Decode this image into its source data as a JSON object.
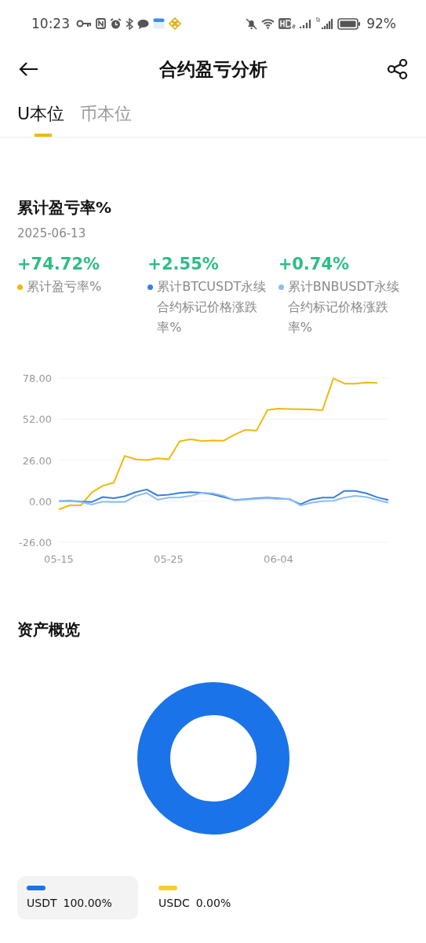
{
  "status_bar": {
    "time": "10:23",
    "battery": "92%"
  },
  "header": {
    "title": "合约盈亏分析"
  },
  "tabs": [
    {
      "label": "U本位",
      "selected": true
    },
    {
      "label": "币本位",
      "selected": false
    }
  ],
  "pnl_section": {
    "title": "累计盈亏率%",
    "date": "2025-06-13",
    "metrics": [
      {
        "value": "+74.72%"
      },
      {
        "value": "+2.55%"
      },
      {
        "value": "+0.74%"
      }
    ],
    "chart_data": {
      "type": "line",
      "categories": [
        "05-15",
        null,
        null,
        null,
        null,
        null,
        null,
        null,
        null,
        null,
        "05-25",
        null,
        null,
        null,
        null,
        null,
        null,
        null,
        null,
        null,
        "06-04",
        null,
        null,
        null,
        null,
        null,
        null,
        null,
        null,
        null,
        null
      ],
      "yticks": [
        {
          "value": 78,
          "label": "78.00"
        },
        {
          "value": 52,
          "label": "52.00"
        },
        {
          "value": 26,
          "label": "26.00"
        },
        {
          "value": 0,
          "label": "0.00"
        },
        {
          "value": -26,
          "label": "-26.00"
        }
      ],
      "ylim": [
        -26,
        78
      ],
      "grid": true,
      "series": [
        {
          "name": "累计盈亏率%",
          "color": "#f0b90b",
          "values": [
            -5.2,
            -2.6,
            -2.6,
            5.5,
            9.8,
            11.7,
            28.7,
            26.5,
            26,
            27.1,
            26.5,
            38,
            39.2,
            38.1,
            38.5,
            38.3,
            42.1,
            45.2,
            44.7,
            57.7,
            58.6,
            58.4,
            58.2,
            58.1,
            57.6,
            77.8,
            74.4,
            74.4,
            75.1,
            74.9,
            null
          ]
        },
        {
          "name": "累计BTCUSDT永续合约标记价格涨跌率%",
          "color": "#3a7fe0",
          "values": [
            0,
            0.2,
            -0.2,
            -0.5,
            2.6,
            1.9,
            3.1,
            5.7,
            7.4,
            3.6,
            4.1,
            5.2,
            5.7,
            5.3,
            4.3,
            2.6,
            0.7,
            1.2,
            1.9,
            2.2,
            1.7,
            1.2,
            -1.9,
            1.0,
            2.2,
            2.2,
            6.5,
            6.5,
            5.0,
            2.4,
            0.7
          ]
        },
        {
          "name": "累计BNBUSDT永续合约标记价格涨跌率%",
          "color": "#8dbdf2",
          "values": [
            0,
            0,
            -0.5,
            -2.1,
            -0.3,
            -0.5,
            -0.5,
            3.3,
            5.2,
            0.9,
            2.2,
            2.4,
            3.3,
            5.3,
            5.0,
            3.4,
            0.5,
            1.0,
            1.5,
            1.9,
            1.4,
            1.5,
            -2.7,
            -1.0,
            0,
            0.2,
            2.2,
            3.3,
            2.6,
            0.7,
            -1.0
          ]
        }
      ]
    }
  },
  "assets_section": {
    "title": "资产概览",
    "legend": [
      {
        "name": "USDT",
        "percent": "100.00%",
        "color": "#1a73e8",
        "selected": true
      },
      {
        "name": "USDC",
        "percent": "0.00%",
        "color": "#f8d12f",
        "selected": false
      }
    ]
  }
}
